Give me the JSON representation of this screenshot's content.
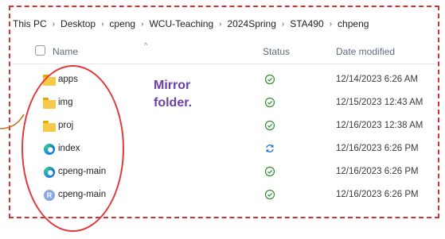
{
  "breadcrumb": [
    "This PC",
    "Desktop",
    "cpeng",
    "WCU-Teaching",
    "2024Spring",
    "STA490",
    "chpeng"
  ],
  "columns": {
    "name": "Name",
    "status": "Status",
    "date_modified": "Date modified"
  },
  "rows": [
    {
      "icon": "folder-icon",
      "name": "apps",
      "status": "synced-check-icon",
      "date": "12/14/2023 6:26 AM"
    },
    {
      "icon": "folder-icon",
      "name": "img",
      "status": "synced-check-icon",
      "date": "12/15/2023 12:43 AM"
    },
    {
      "icon": "folder-icon",
      "name": "proj",
      "status": "synced-check-icon",
      "date": "12/16/2023 12:38 AM"
    },
    {
      "icon": "edge-html-icon",
      "name": "index",
      "status": "syncing-icon",
      "date": "12/16/2023 6:26 PM"
    },
    {
      "icon": "edge-html-icon",
      "name": "cpeng-main",
      "status": "synced-check-icon",
      "date": "12/16/2023 6:26 PM"
    },
    {
      "icon": "r-file-icon",
      "name": "cpeng-main",
      "status": "synced-check-icon",
      "date": "12/16/2023 6:26 PM"
    }
  ],
  "annotation": {
    "line1": "Mirror",
    "line2": "folder."
  },
  "colors": {
    "annotation_text": "#6b3fa8",
    "highlight": "#e23a3a",
    "frame": "#d23232",
    "sync_green": "#2f8f2f",
    "sync_blue": "#1f6fd0"
  }
}
